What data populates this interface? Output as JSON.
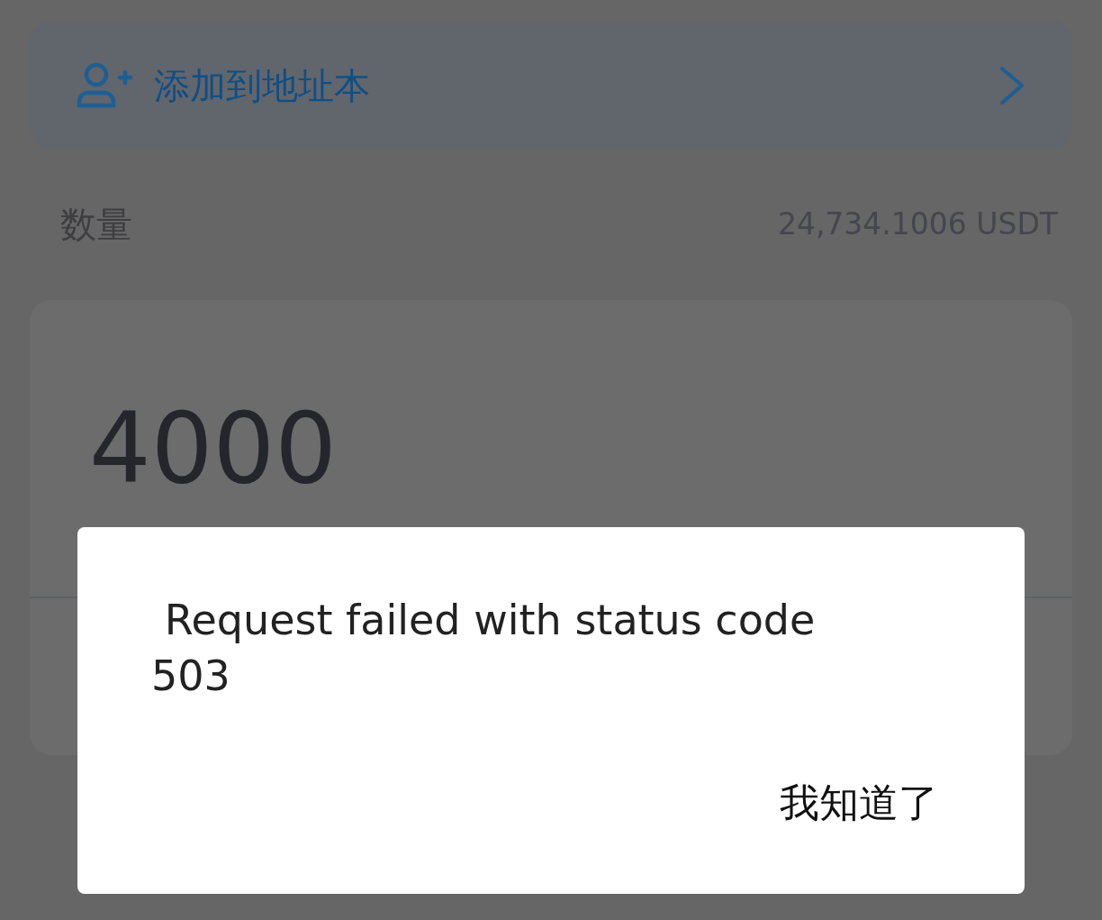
{
  "address_book_row": {
    "label": "添加到地址本"
  },
  "amount": {
    "label": "数量",
    "balance": "24,734.1006 USDT",
    "value": "4000"
  },
  "dialog": {
    "message": " Request failed with status code 503",
    "button": "我知道了"
  }
}
